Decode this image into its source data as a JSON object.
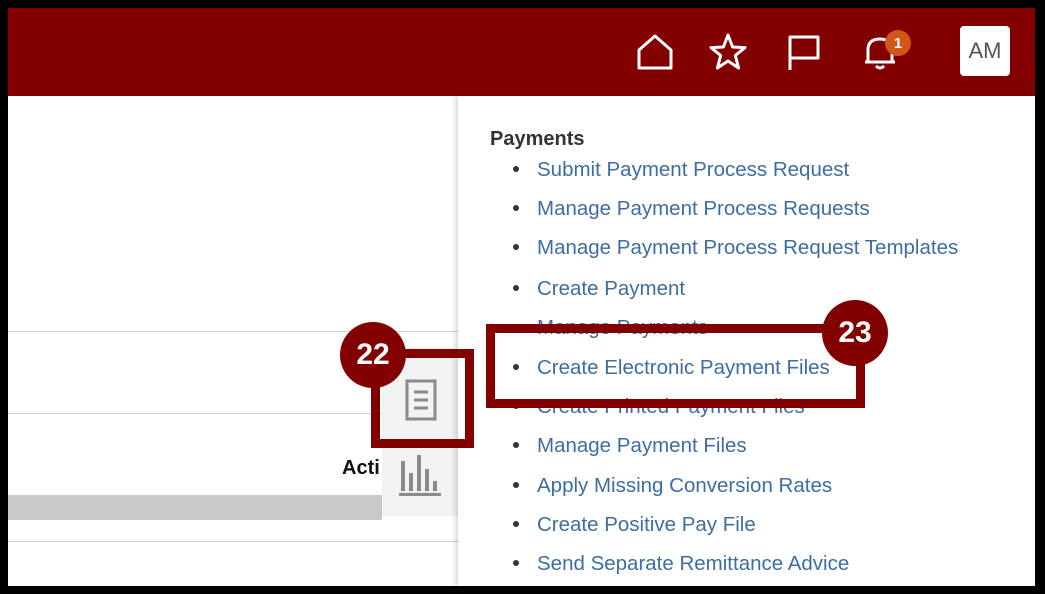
{
  "header": {
    "icons": [
      "home-icon",
      "star-icon",
      "flag-icon",
      "bell-icon"
    ],
    "notification_count": "1",
    "avatar_initials": "AM",
    "bar_color": "#820000"
  },
  "left_panel": {
    "column_header_partial": "Acti"
  },
  "tasks_panel": {
    "heading": "Payments",
    "items": [
      "Submit Payment Process Request",
      "Manage Payment Process Requests",
      "Manage Payment Process Request Templates",
      "Create Payment",
      "Manage Payments",
      "Create Electronic Payment Files",
      "Create Printed Payment Files",
      "Manage Payment Files",
      "Apply Missing Conversion Rates",
      "Create Positive Pay File",
      "Send Separate Remittance Advice"
    ],
    "link_color": "#3d6da3"
  },
  "annotations": {
    "step_a": "22",
    "step_b": "23"
  }
}
